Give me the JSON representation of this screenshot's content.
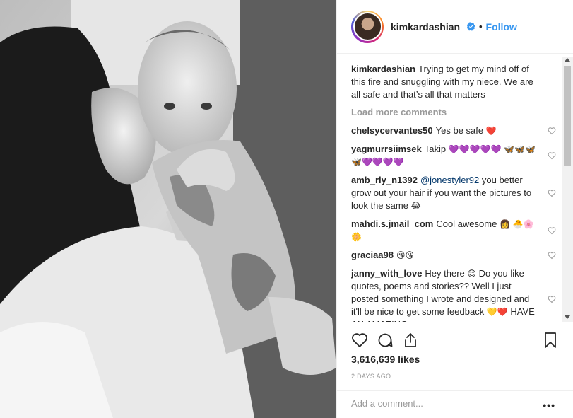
{
  "header": {
    "username": "kimkardashian",
    "dot": "•",
    "follow_label": "Follow"
  },
  "caption": {
    "username": "kimkardashian",
    "text": "Trying to get my mind off of this fire and snuggling with my niece. We are all safe and that’s all that matters"
  },
  "load_more_label": "Load more comments",
  "comments": [
    {
      "username": "chelsycervantes50",
      "text": "Yes be safe",
      "emoji": "❤️"
    },
    {
      "username": "yagmurrsiimsek",
      "text": "Takip",
      "emoji": "💜💜💜💜💜 🦋🦋🦋🦋💜💜💜💜"
    },
    {
      "username": "amb_rly_n1392",
      "mention": "@jonestyler92",
      "text": "you better grow out your hair if you want the pictures to look the same",
      "emoji": "😂"
    },
    {
      "username": "mahdi.s.jmail_com",
      "text": "Cool awesome",
      "emoji": "👩 🐣🌸🌼"
    },
    {
      "username": "graciaa98",
      "text": "",
      "emoji": "😘😘"
    },
    {
      "username": "janny_with_love",
      "text": "Hey there",
      "emoji_mid": "😊",
      "text2": "Do you like quotes, poems and stories?? Well I just posted something I wrote and designed and it'll be nice to get some feedback",
      "emoji": "💛❤️",
      "text3": "HAVE AN AMAZING"
    }
  ],
  "likes": "3,616,639 likes",
  "date": "2 DAYS AGO",
  "add_comment": {
    "placeholder": "Add a comment..."
  },
  "more_label": "•••",
  "colors": {
    "accent": "#3897f0",
    "verified": "#3897f0",
    "muted": "#999999",
    "text": "#262626"
  },
  "icons": [
    "heart-icon",
    "comment-icon",
    "share-icon",
    "bookmark-icon",
    "verified-badge-icon",
    "small-heart-icon"
  ]
}
